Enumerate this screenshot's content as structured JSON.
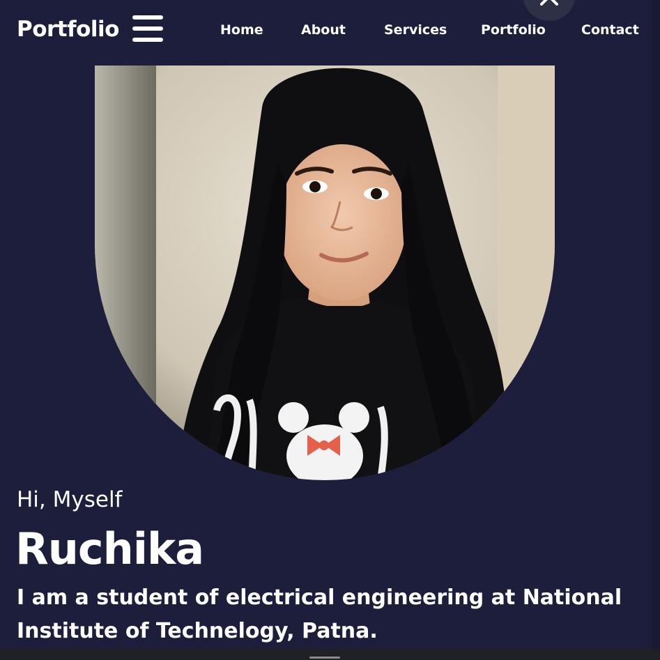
{
  "navbar": {
    "brand": "Portfolio",
    "menu_icon": "hamburger-menu-icon",
    "close_icon": "close-icon",
    "links": [
      "Home",
      "About",
      "Services",
      "Portfolio",
      "Contact"
    ]
  },
  "hero": {
    "photo_icon": "profile-photo",
    "greeting": "Hi, Myself",
    "name": "Ruchika",
    "bio": "I am a student of electrical engineering at National Institute of Technelogy, Patna."
  },
  "colors": {
    "background": "#1c1e3b",
    "text": "#ffffff"
  }
}
